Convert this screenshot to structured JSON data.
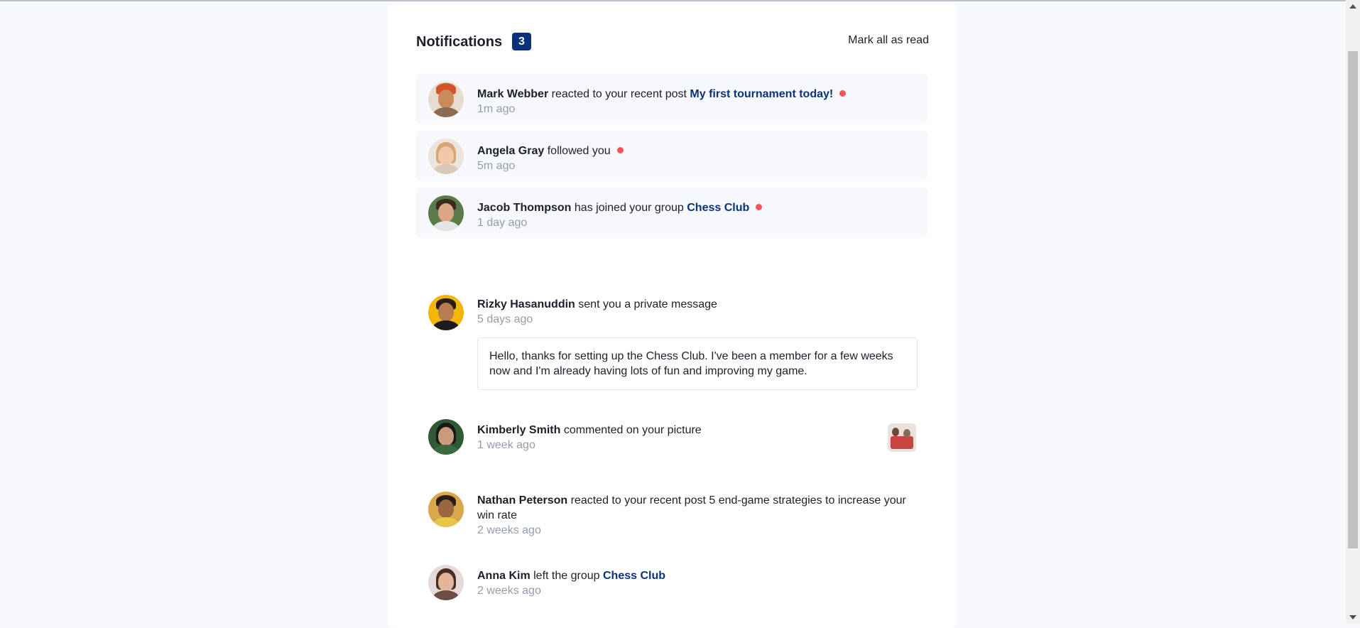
{
  "header": {
    "title": "Notifications",
    "unread_count": "3",
    "mark_all_label": "Mark all as read"
  },
  "notifications": [
    {
      "name": "Mark Webber",
      "action": "reacted to your recent post",
      "target": "My first tournament today!",
      "time": "1m ago",
      "unread": true
    },
    {
      "name": "Angela Gray",
      "action": "followed you",
      "target": "",
      "time": "5m ago",
      "unread": true
    },
    {
      "name": "Jacob Thompson",
      "action": "has joined your group",
      "target": "Chess Club",
      "time": "1 day ago",
      "unread": true
    },
    {
      "name": "Rizky Hasanuddin",
      "action": "sent you a private message",
      "target": "",
      "time": "5 days ago",
      "unread": false,
      "message": "Hello, thanks for setting up the Chess Club. I've been a member for a few weeks now and I'm already having lots of fun and improving my game."
    },
    {
      "name": "Kimberly Smith",
      "action": "commented on your picture",
      "target": "",
      "time": "1 week ago",
      "unread": false
    },
    {
      "name": "Nathan Peterson",
      "action": "reacted to your recent post",
      "target": "5 end-game strategies to increase your win rate",
      "time": "2 weeks ago",
      "unread": false
    },
    {
      "name": "Anna Kim",
      "action": "left the group",
      "target": "Chess Club",
      "time": "2 weeks ago",
      "unread": false
    }
  ],
  "colors": {
    "accent": "#0a327b",
    "unread_dot": "#f65552",
    "unread_bg": "#f6f8fc",
    "muted_text": "#939dae"
  }
}
